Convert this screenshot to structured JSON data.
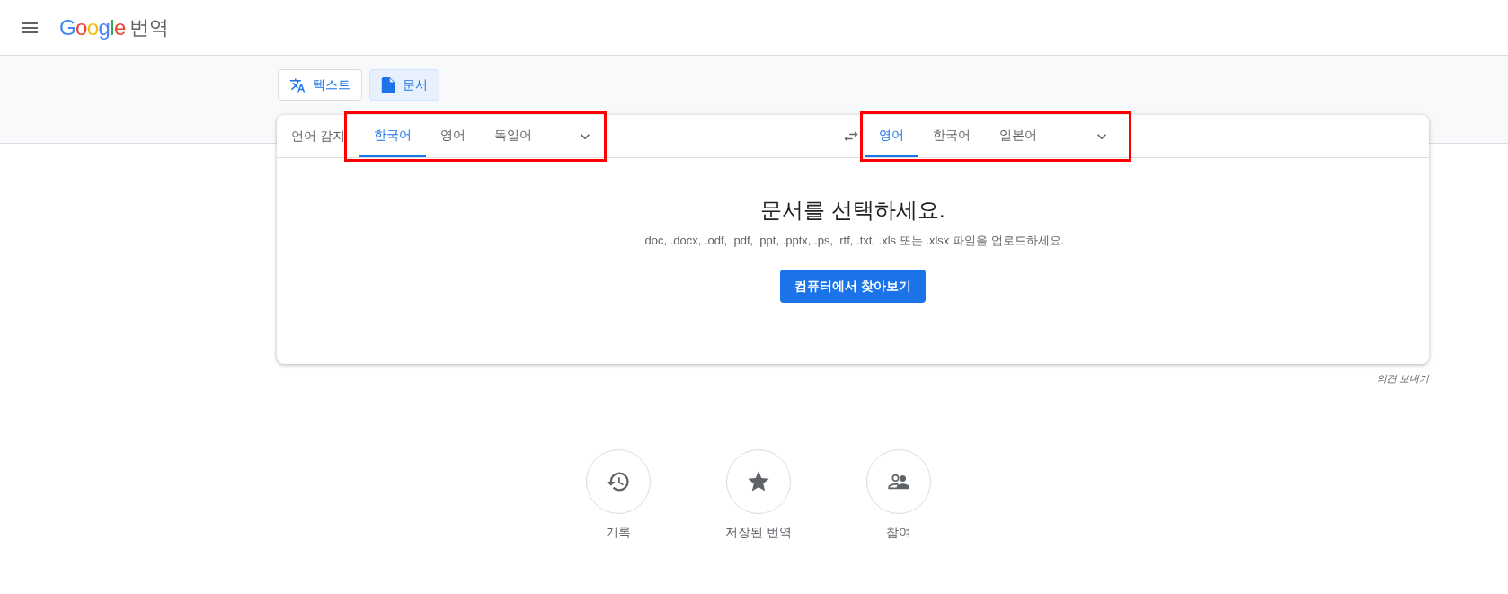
{
  "header": {
    "logo": "Google",
    "product": "번역"
  },
  "modes": [
    {
      "label": "텍스트",
      "kind": "text",
      "selected": false
    },
    {
      "label": "문서",
      "kind": "document",
      "selected": true
    }
  ],
  "source_languages": {
    "detect": "언어 감지",
    "tabs": [
      {
        "label": "한국어",
        "selected": true
      },
      {
        "label": "영어",
        "selected": false
      },
      {
        "label": "독일어",
        "selected": false
      }
    ]
  },
  "target_languages": {
    "tabs": [
      {
        "label": "영어",
        "selected": true
      },
      {
        "label": "한국어",
        "selected": false
      },
      {
        "label": "일본어",
        "selected": false
      }
    ]
  },
  "document": {
    "title": "문서를 선택하세요.",
    "subtitle": ".doc, .docx, .odf, .pdf, .ppt, .pptx, .ps, .rtf, .txt, .xls 또는 .xlsx 파일을 업로드하세요.",
    "button": "컴퓨터에서 찾아보기"
  },
  "feedback": "의견 보내기",
  "shortcuts": [
    {
      "label": "기록",
      "kind": "history"
    },
    {
      "label": "저장된 번역",
      "kind": "saved"
    },
    {
      "label": "참여",
      "kind": "community"
    }
  ]
}
